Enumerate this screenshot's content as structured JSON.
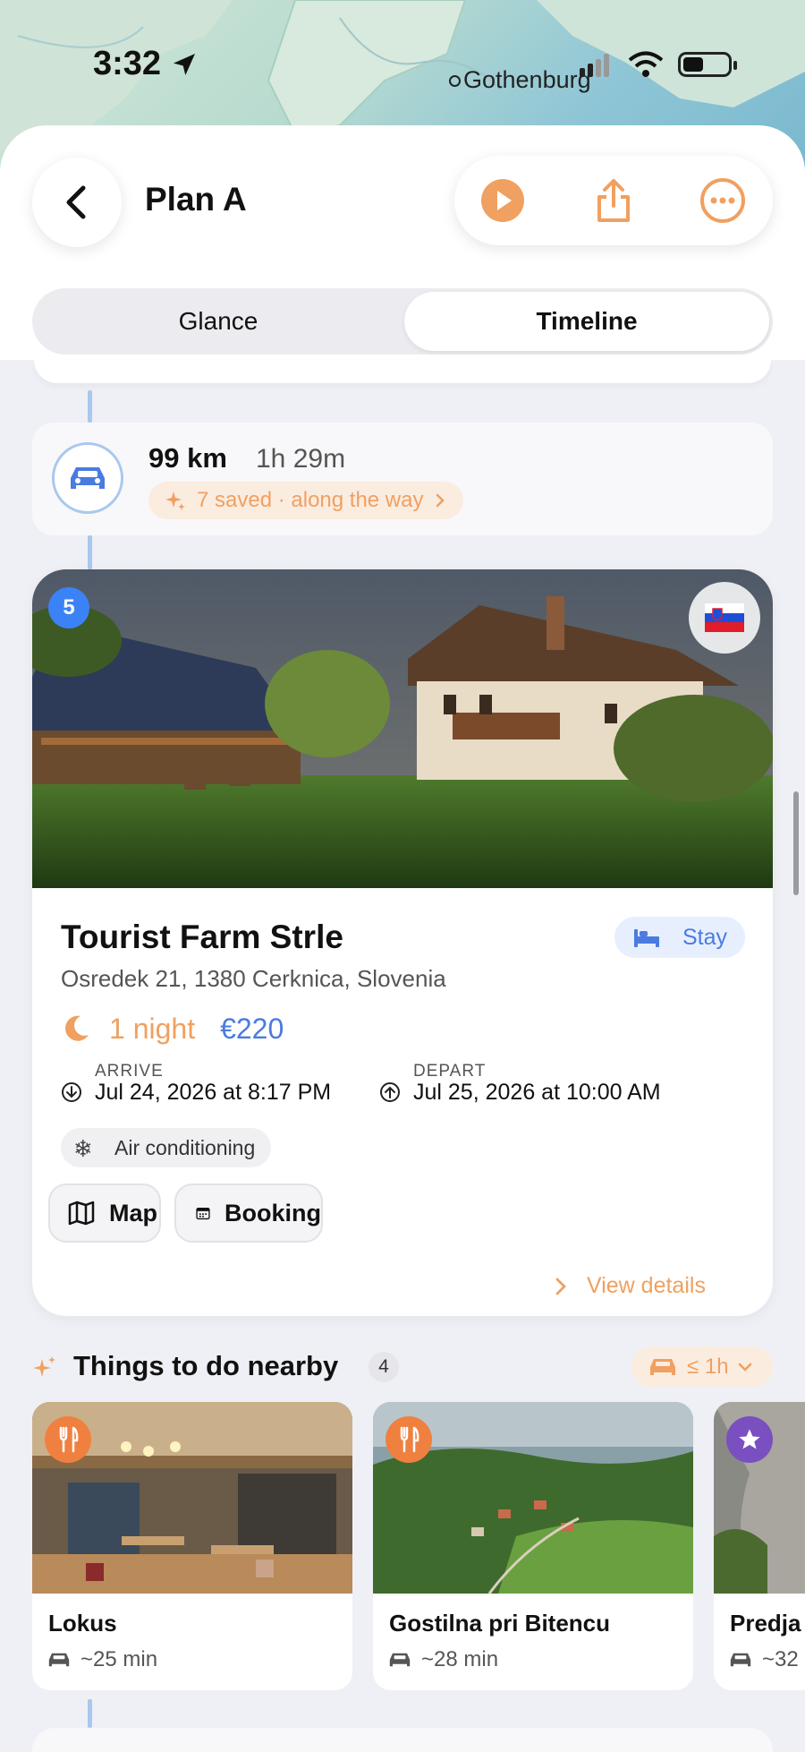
{
  "status_bar": {
    "time": "3:32",
    "location": "Gothenburg"
  },
  "header": {
    "title": "Plan A",
    "actions": [
      "play-icon",
      "share-icon",
      "more-icon"
    ]
  },
  "tabs": {
    "glance": "Glance",
    "timeline": "Timeline",
    "selected": "Timeline"
  },
  "travel": {
    "distance": "99 km",
    "duration": "1h 29m",
    "saved": "7 saved · along the way"
  },
  "stay": {
    "order": "5",
    "country_flag": "Slovenia",
    "name": "Tourist Farm Strle",
    "type": "Stay",
    "address": "Osredek 21, 1380 Cerknica, Slovenia",
    "nights": "1 night",
    "price": "€220",
    "arrive_label": "ARRIVE",
    "arrive": "Jul 24, 2026 at 8:17 PM",
    "depart_label": "DEPART",
    "depart": "Jul 25, 2026 at 10:00 AM",
    "amenity": "Air conditioning",
    "map_button": "Map",
    "booking_button": "Booking",
    "view_details": "View details"
  },
  "nearby": {
    "title": "Things to do nearby",
    "count": "4",
    "filter": "≤ 1h",
    "items": [
      {
        "name": "Lokus",
        "time": "~25 min",
        "category": "restaurant"
      },
      {
        "name": "Gostilna pri Bitencu",
        "time": "~28 min",
        "category": "restaurant"
      },
      {
        "name": "Predja",
        "time": "~32",
        "category": "attraction"
      }
    ]
  },
  "colors": {
    "accent_orange": "#f0a060",
    "accent_blue": "#4a7be0",
    "badge_blue": "#3b82f6",
    "attraction_purple": "#7a4fc0"
  }
}
